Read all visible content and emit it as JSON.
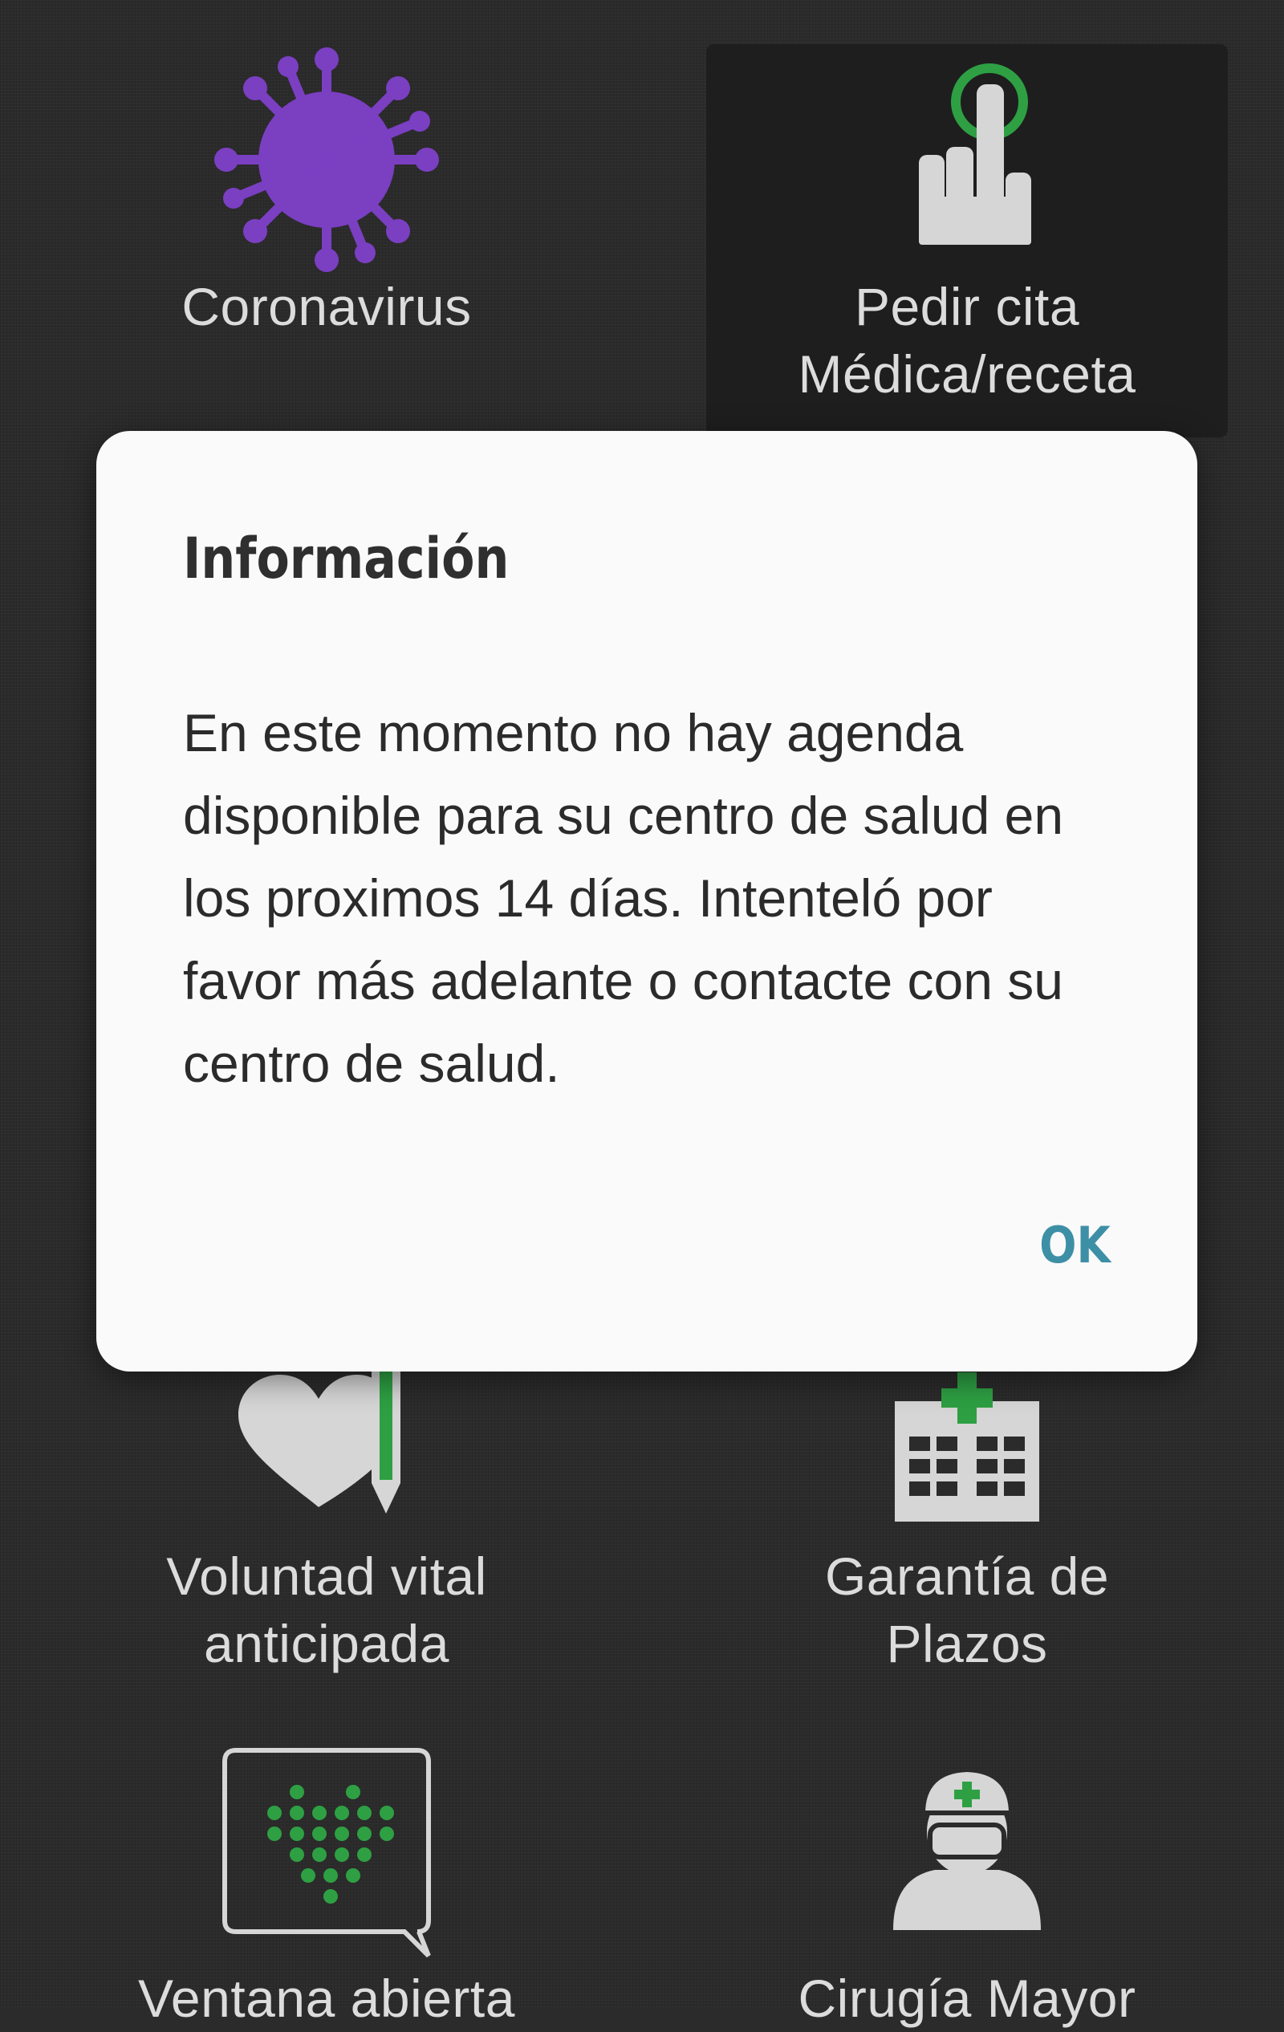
{
  "tiles": [
    {
      "label": "Coronavirus",
      "icon": "virus-icon",
      "color": "#7b3fc2"
    },
    {
      "label": "Pedir cita\nMédica/receta",
      "icon": "tap-hand-icon",
      "color": "#2ea043"
    },
    {
      "label": "Voluntad vital\nanticipada",
      "icon": "heart-pen-icon",
      "color": "#2ea043"
    },
    {
      "label": "Garantía de\nPlazos",
      "icon": "hospital-icon",
      "color": "#2ea043"
    },
    {
      "label": "Ventana abierta",
      "icon": "chat-heart-icon",
      "color": "#2ea043"
    },
    {
      "label": "Cirugía Mayor",
      "icon": "surgeon-icon",
      "color": "#2ea043"
    }
  ],
  "dialog": {
    "title": "Información",
    "message": "En este momento no hay agenda disponible para su centro de salud en los proximos 14 días. Intenteló por favor más adelante o contacte con su centro de salud.",
    "ok_label": "OK"
  },
  "colors": {
    "background": "#2b2b2b",
    "accent_green": "#2ea043",
    "accent_purple": "#7b3fc2",
    "ok_button": "#3d8fa6"
  }
}
